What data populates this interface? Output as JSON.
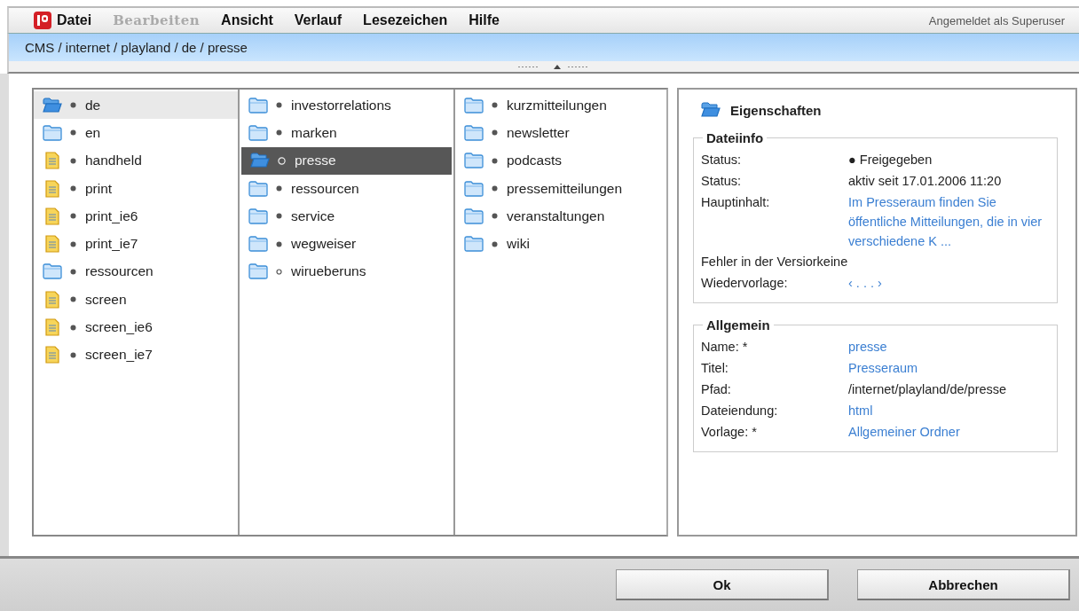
{
  "menu": [
    {
      "label": "Datei",
      "disabled": false
    },
    {
      "label": "Bearbeiten",
      "disabled": true
    },
    {
      "label": "Ansicht",
      "disabled": false
    },
    {
      "label": "Verlauf",
      "disabled": false
    },
    {
      "label": "Lesezeichen",
      "disabled": false
    },
    {
      "label": "Hilfe",
      "disabled": false
    }
  ],
  "user_label": "Angemeldet als Superuser",
  "breadcrumb": "CMS / internet / playland / de / presse",
  "columns": [
    [
      {
        "name": "de",
        "kind": "open-folder",
        "published": true,
        "selected": false,
        "in_path": true
      },
      {
        "name": "en",
        "kind": "folder",
        "published": true,
        "selected": false,
        "in_path": false
      },
      {
        "name": "handheld",
        "kind": "document",
        "published": true,
        "selected": false,
        "in_path": false
      },
      {
        "name": "print",
        "kind": "document",
        "published": true,
        "selected": false,
        "in_path": false
      },
      {
        "name": "print_ie6",
        "kind": "document",
        "published": true,
        "selected": false,
        "in_path": false
      },
      {
        "name": "print_ie7",
        "kind": "document",
        "published": true,
        "selected": false,
        "in_path": false
      },
      {
        "name": "ressourcen",
        "kind": "folder",
        "published": true,
        "selected": false,
        "in_path": false
      },
      {
        "name": "screen",
        "kind": "document",
        "published": true,
        "selected": false,
        "in_path": false
      },
      {
        "name": "screen_ie6",
        "kind": "document",
        "published": true,
        "selected": false,
        "in_path": false
      },
      {
        "name": "screen_ie7",
        "kind": "document",
        "published": true,
        "selected": false,
        "in_path": false
      }
    ],
    [
      {
        "name": "investorrelations",
        "kind": "folder",
        "published": true,
        "selected": false,
        "in_path": false
      },
      {
        "name": "marken",
        "kind": "folder",
        "published": true,
        "selected": false,
        "in_path": false
      },
      {
        "name": "presse",
        "kind": "open-folder",
        "published": true,
        "selected": true,
        "in_path": true
      },
      {
        "name": "ressourcen",
        "kind": "folder",
        "published": true,
        "selected": false,
        "in_path": false
      },
      {
        "name": "service",
        "kind": "folder",
        "published": true,
        "selected": false,
        "in_path": false
      },
      {
        "name": "wegweiser",
        "kind": "folder",
        "published": true,
        "selected": false,
        "in_path": false
      },
      {
        "name": "wirueberuns",
        "kind": "folder",
        "published": false,
        "selected": false,
        "in_path": false
      }
    ],
    [
      {
        "name": "kurzmitteilungen",
        "kind": "folder",
        "published": true,
        "selected": false,
        "in_path": false
      },
      {
        "name": "newsletter",
        "kind": "folder",
        "published": true,
        "selected": false,
        "in_path": false
      },
      {
        "name": "podcasts",
        "kind": "folder",
        "published": true,
        "selected": false,
        "in_path": false
      },
      {
        "name": "pressemitteilungen",
        "kind": "folder",
        "published": true,
        "selected": false,
        "in_path": false
      },
      {
        "name": "veranstaltungen",
        "kind": "folder",
        "published": true,
        "selected": false,
        "in_path": false
      },
      {
        "name": "wiki",
        "kind": "folder",
        "published": true,
        "selected": false,
        "in_path": false
      }
    ]
  ],
  "properties": {
    "title": "Eigenschaften",
    "groups": [
      {
        "title": "Dateiinfo",
        "rows": [
          {
            "kind": "pair",
            "label": "Status:",
            "value": "● Freigegeben",
            "link": false
          },
          {
            "kind": "pair",
            "label": "Status:",
            "value": "aktiv seit 17.01.2006 11:20",
            "link": false
          },
          {
            "kind": "pair",
            "label": "Hauptinhalt:",
            "value": "Im Presseraum finden Sie öffentliche Mitteilungen, die in vier verschiedene K ...",
            "link": true
          },
          {
            "kind": "inline",
            "label": "Fehler in der Versior",
            "value": "keine",
            "link": false
          },
          {
            "kind": "pair",
            "label": "Wiedervorlage:",
            "value": "‹ . . . ›",
            "link": true
          }
        ]
      },
      {
        "title": "Allgemein",
        "rows": [
          {
            "kind": "pair",
            "label": "Name: *",
            "value": "presse",
            "link": true
          },
          {
            "kind": "pair",
            "label": "Titel:",
            "value": "Presseraum",
            "link": true
          },
          {
            "kind": "pair",
            "label": "Pfad:",
            "value": "/internet/playland/de/presse",
            "link": false
          },
          {
            "kind": "pair",
            "label": "Dateiendung:",
            "value": "html",
            "link": true
          },
          {
            "kind": "pair",
            "label": "Vorlage: *",
            "value": "Allgemeiner Ordner",
            "link": true
          }
        ]
      }
    ]
  },
  "buttons": [
    "Ok",
    "Abbrechen"
  ]
}
